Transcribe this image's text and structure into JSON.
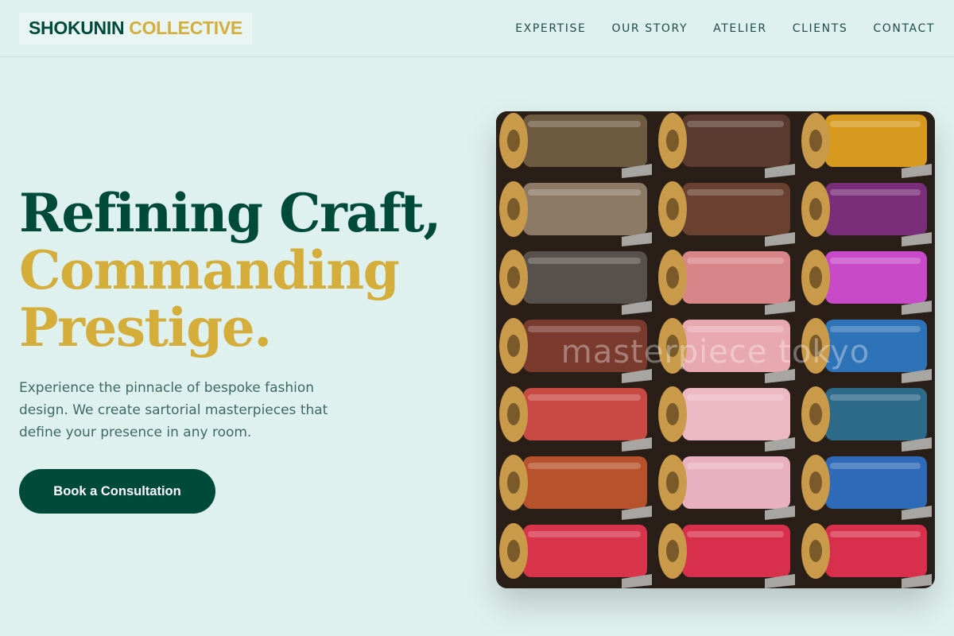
{
  "brand": {
    "part1": "SHOKUNIN",
    "part2": "COLLECTIVE"
  },
  "nav": {
    "items": [
      {
        "label": "EXPERTISE",
        "name": "nav-item-expertise"
      },
      {
        "label": "OUR STORY",
        "name": "nav-item-our-story"
      },
      {
        "label": "ATELIER",
        "name": "nav-item-atelier"
      },
      {
        "label": "CLIENTS",
        "name": "nav-item-clients"
      },
      {
        "label": "CONTACT",
        "name": "nav-item-contact"
      }
    ]
  },
  "hero": {
    "headline_line1": "Refining Craft,",
    "headline_line2": "Commanding",
    "headline_line3": "Prestige.",
    "description": "Experience the pinnacle of bespoke fashion design. We create sartorial masterpieces that define your presence in any room.",
    "cta_label": "Book a Consultation",
    "image_watermark": "masterpiece tokyo"
  },
  "colors": {
    "background": "#dff1ef",
    "primary": "#004a3a",
    "accent": "#d4ad3a",
    "body_text": "#3d6962"
  },
  "thread_spools": {
    "columns": [
      [
        "#6e5a40",
        "#8c7a66",
        "#58504c",
        "#7a3a2e",
        "#c94a44",
        "#b8522c",
        "#d8344c"
      ],
      [
        "#5a3a2e",
        "#6a4030",
        "#d8858a",
        "#e8a8b0",
        "#ecb8c4",
        "#e8b0c0",
        "#d8304c"
      ],
      [
        "#d89a1e",
        "#7a2e7a",
        "#c84ac8",
        "#2e72b8",
        "#2e6a8a",
        "#2e6ab8",
        "#d8304c"
      ]
    ]
  }
}
